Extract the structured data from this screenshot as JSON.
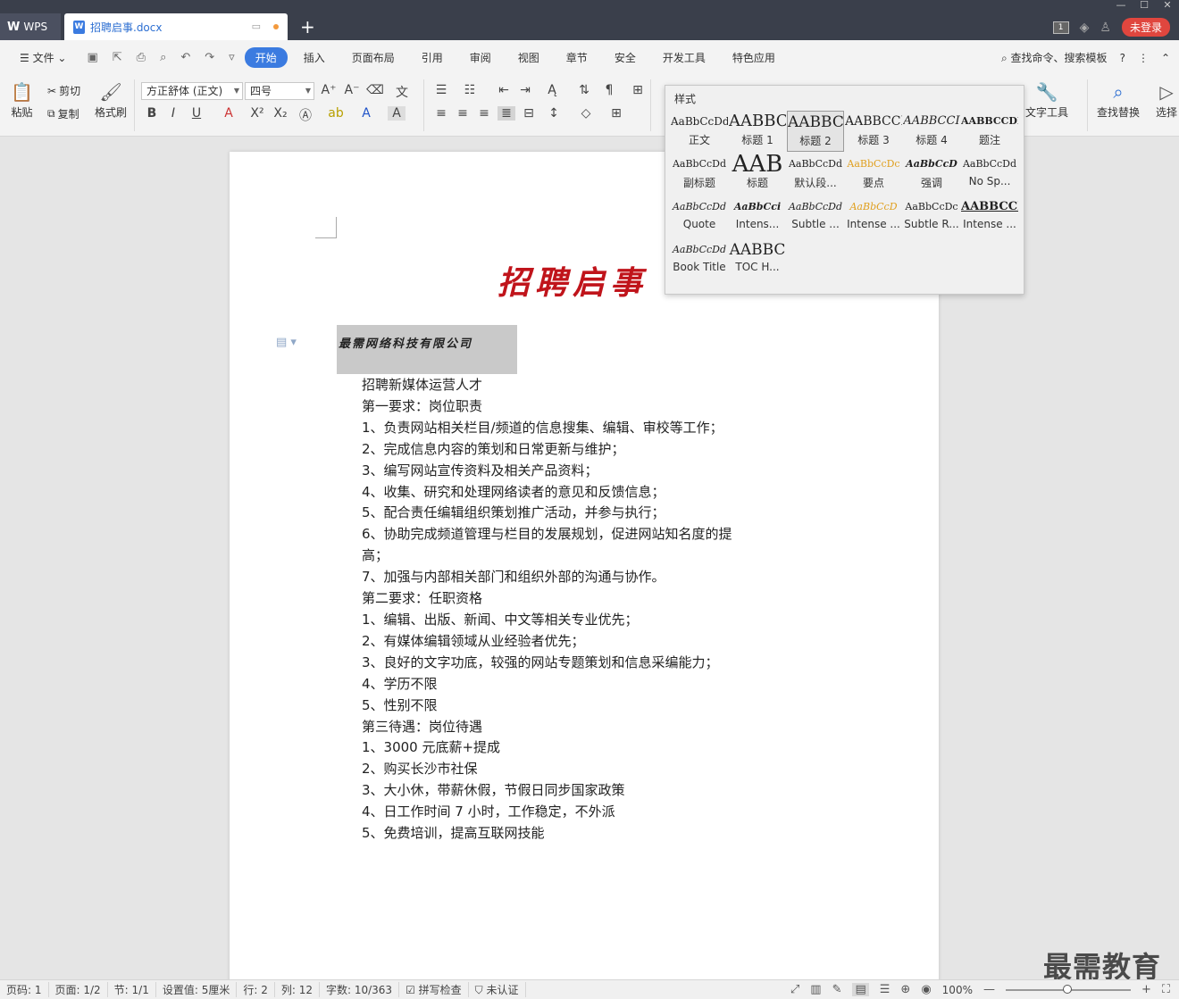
{
  "titlebar": {
    "app_tab": "WPS",
    "doc_tab": "招聘启事.docx",
    "page_indicator": "1",
    "login": "未登录"
  },
  "menubar": {
    "file": "文件",
    "items": [
      "开始",
      "插入",
      "页面布局",
      "引用",
      "审阅",
      "视图",
      "章节",
      "安全",
      "开发工具",
      "特色应用"
    ],
    "search": "查找命令、搜索模板"
  },
  "ribbon": {
    "paste": "粘贴",
    "cut": "剪切",
    "copy": "复制",
    "format_painter": "格式刷",
    "font": "方正舒体 (正文)",
    "size": "四号",
    "text_tools": "文字工具",
    "find_replace": "查找替换",
    "select": "选择"
  },
  "styles_popup": {
    "header": "样式",
    "items": [
      {
        "preview": "AaBbCcDd",
        "label": "正文"
      },
      {
        "preview": "AABBC",
        "label": "标题 1"
      },
      {
        "preview": "AABBC(",
        "label": "标题 2"
      },
      {
        "preview": "AABBCCI",
        "label": "标题 3"
      },
      {
        "preview": "AABBCCI",
        "label": "标题 4"
      },
      {
        "preview": "AABBCCDD",
        "label": "题注"
      },
      {
        "preview": "AaBbCcDd",
        "label": "副标题"
      },
      {
        "preview": "AAB",
        "label": "标题"
      },
      {
        "preview": "AaBbCcDd",
        "label": "默认段..."
      },
      {
        "preview": "AaBbCcDc",
        "label": "要点"
      },
      {
        "preview": "AaBbCcD",
        "label": "强调"
      },
      {
        "preview": "AaBbCcDd",
        "label": "No Sp..."
      },
      {
        "preview": "AaBbCcDd",
        "label": "Quote"
      },
      {
        "preview": "AaBbCci",
        "label": "Intens..."
      },
      {
        "preview": "AaBbCcDd",
        "label": "Subtle ..."
      },
      {
        "preview": "AaBbCcD",
        "label": "Intense ..."
      },
      {
        "preview": "AaBbCcDc",
        "label": "Subtle R..."
      },
      {
        "preview": "AABBCCI",
        "label": "Intense ..."
      },
      {
        "preview": "AaBbCcDd",
        "label": "Book Title"
      },
      {
        "preview": "AABBC",
        "label": "TOC H..."
      }
    ]
  },
  "document": {
    "title": "招聘启事",
    "company": "最需网络科技有限公司",
    "lines": [
      "招聘新媒体运营人才",
      "第一要求：岗位职责",
      "1、负责网站相关栏目/频道的信息搜集、编辑、审校等工作；",
      "2、完成信息内容的策划和日常更新与维护；",
      "3、编写网站宣传资料及相关产品资料；",
      "4、收集、研究和处理网络读者的意见和反馈信息；",
      "5、配合责任编辑组织策划推广活动，并参与执行；",
      "6、协助完成频道管理与栏目的发展规划，促进网站知名度的提",
      "高；",
      "7、加强与内部相关部门和组织外部的沟通与协作。",
      "第二要求：任职资格",
      "1、编辑、出版、新闻、中文等相关专业优先；",
      "2、有媒体编辑领域从业经验者优先；",
      "3、良好的文字功底，较强的网站专题策划和信息采编能力；",
      "4、学历不限",
      "5、性别不限",
      "第三待遇：岗位待遇",
      "1、3000 元底薪+提成",
      "2、购买长沙市社保",
      "3、大小休，带薪休假，节假日同步国家政策",
      "4、日工作时间 7 小时，工作稳定，不外派",
      "5、免费培训，提高互联网技能"
    ]
  },
  "watermark": "最需教育",
  "statusbar": {
    "page_no": "页码: 1",
    "pages": "页面: 1/2",
    "section": "节: 1/1",
    "setting": "设置值: 5厘米",
    "row": "行: 2",
    "col": "列: 12",
    "words": "字数: 10/363",
    "spell": "拼写检查",
    "cert": "未认证",
    "zoom": "100%"
  }
}
